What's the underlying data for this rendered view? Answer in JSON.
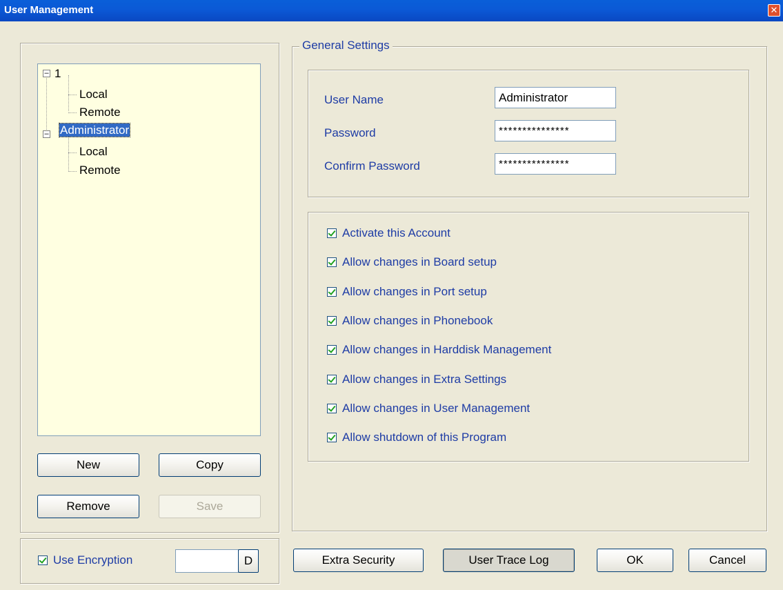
{
  "window": {
    "title": "User Management",
    "close_glyph": "✕"
  },
  "tree": {
    "users": [
      {
        "name": "1",
        "children": [
          "Local",
          "Remote"
        ],
        "selected": false
      },
      {
        "name": "Administrator",
        "children": [
          "Local",
          "Remote"
        ],
        "selected": true
      }
    ]
  },
  "left_buttons": {
    "new": "New",
    "copy": "Copy",
    "remove": "Remove",
    "save": "Save"
  },
  "encryption": {
    "label": "Use Encryption",
    "checked": true,
    "value": "",
    "button": "D"
  },
  "general": {
    "title": "General Settings",
    "user_name_label": "User Name",
    "user_name_value": "Administrator",
    "password_label": "Password",
    "password_value": "***************",
    "confirm_label": "Confirm Password",
    "confirm_value": "***************"
  },
  "permissions": [
    "Activate this Account",
    "Allow changes in Board setup",
    "Allow changes in Port setup",
    "Allow changes in Phonebook",
    "Allow changes in Harddisk Management",
    "Allow changes in Extra Settings",
    "Allow changes in User Management",
    "Allow shutdown of this Program"
  ],
  "bottom_buttons": {
    "extra_security": "Extra Security",
    "user_trace_log": "User Trace Log",
    "ok": "OK",
    "cancel": "Cancel"
  },
  "colors": {
    "title_bar": "#0b59d6",
    "label_blue": "#1e3ca5",
    "tree_bg": "#ffffe1",
    "selection": "#316ac5"
  }
}
